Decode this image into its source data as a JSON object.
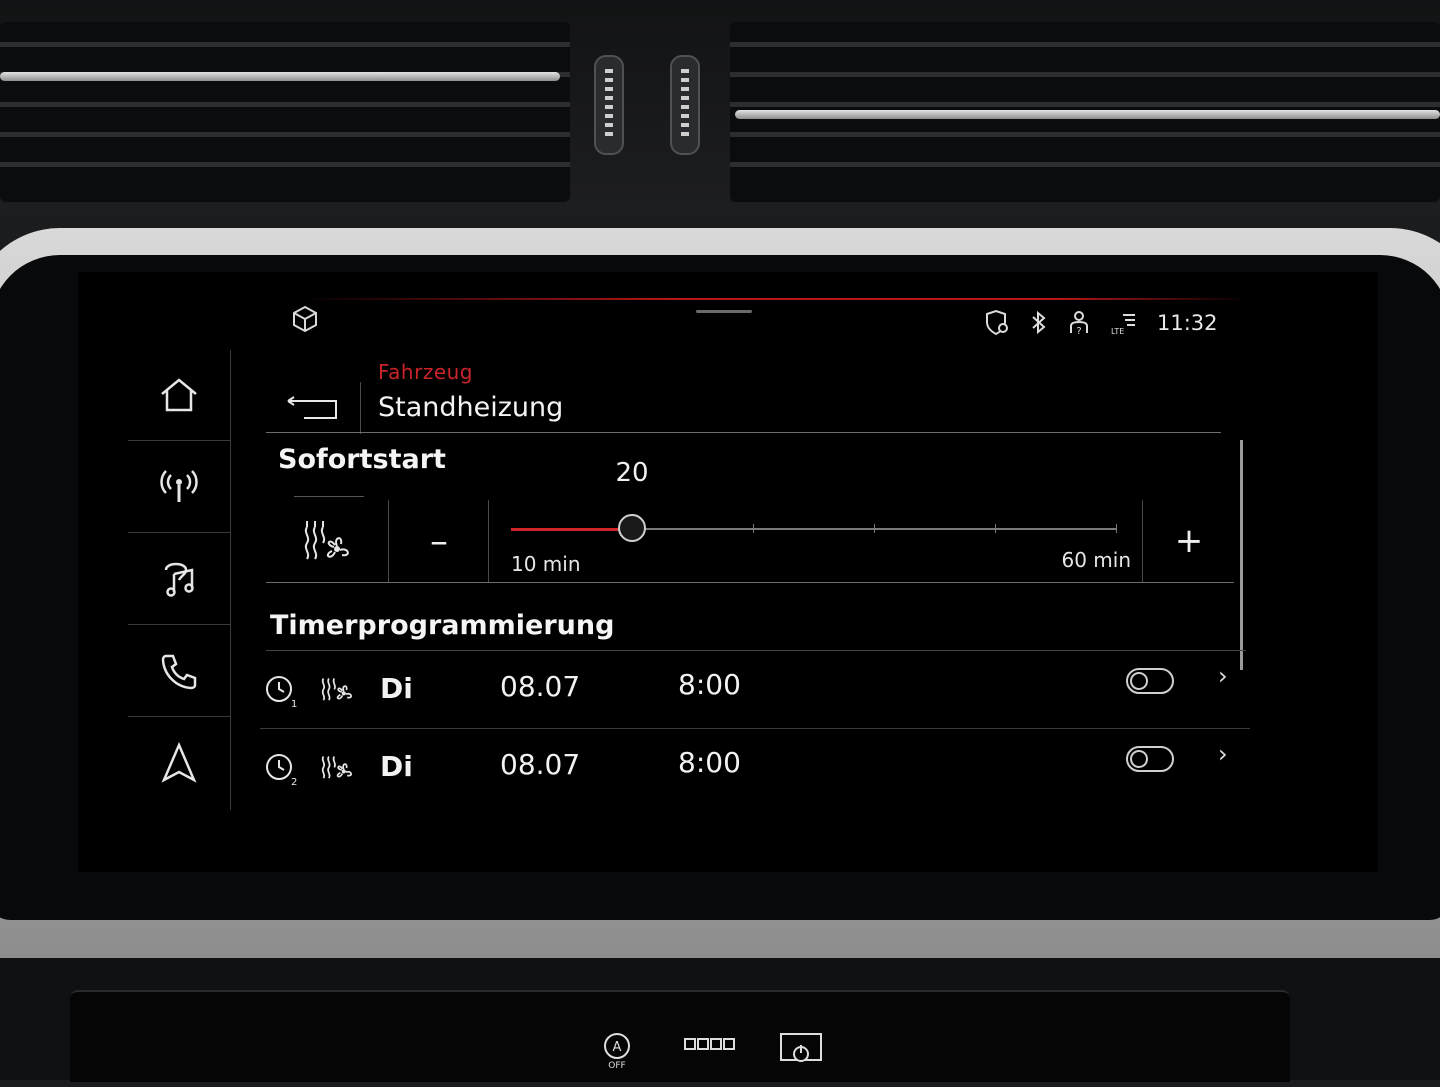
{
  "status_bar": {
    "time": "11:32",
    "icons": [
      "cube-icon",
      "shield-location-icon",
      "bluetooth-icon",
      "person-question-icon",
      "lte-signal-icon"
    ]
  },
  "nav": {
    "items": [
      {
        "name": "nav-home",
        "icon": "home-icon"
      },
      {
        "name": "nav-radio",
        "icon": "antenna-icon"
      },
      {
        "name": "nav-media",
        "icon": "music-icon"
      },
      {
        "name": "nav-phone",
        "icon": "phone-icon"
      },
      {
        "name": "nav-navigation",
        "icon": "navigation-arrow-icon"
      }
    ]
  },
  "header": {
    "breadcrumb": "Fahrzeug",
    "title": "Standheizung"
  },
  "sofortstart": {
    "title": "Sofortstart",
    "minus_label": "–",
    "plus_label": "+",
    "slider": {
      "value": 20,
      "value_label": "20",
      "min": 10,
      "max": 60,
      "min_label": "10 min",
      "max_label": "60 min"
    }
  },
  "timer": {
    "title": "Timerprogrammierung",
    "rows": [
      {
        "index": "1",
        "day": "Di",
        "date": "08.07",
        "time": "8:00",
        "enabled": false
      },
      {
        "index": "2",
        "day": "Di",
        "date": "08.07",
        "time": "8:00",
        "enabled": false
      }
    ]
  },
  "lower_controls": {
    "items": [
      "auto-start-stop-off-icon",
      "parking-sensor-icon",
      "display-power-icon"
    ],
    "auto_off_label": "OFF"
  },
  "colors": {
    "accent_red": "#c8242a",
    "screen_bg": "#000000",
    "text": "#f2f2f2"
  }
}
